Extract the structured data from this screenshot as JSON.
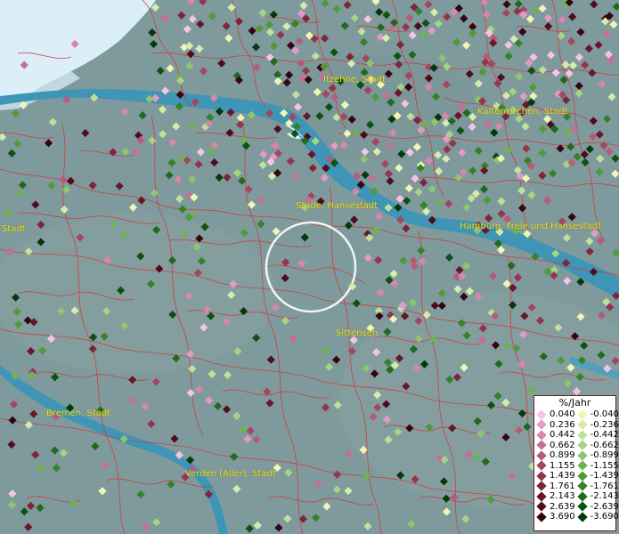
{
  "map": {
    "cities": [
      {
        "name": "Itzehoe, Stadt"
      },
      {
        "name": "Kaltenkirchen, Stadt"
      },
      {
        "name": "Stade, Hansestadt"
      },
      {
        "name": "Hamburg, Freie und Hansestadt"
      },
      {
        "name": "Stadt"
      },
      {
        "name": "Sittensen"
      },
      {
        "name": "Bremen, Stadt"
      },
      {
        "name": "Verden (Aller), Stadt"
      }
    ]
  },
  "legend": {
    "title": "%/Jahr",
    "positive": [
      {
        "value": "0.040",
        "color": "#f4c4e6"
      },
      {
        "value": "0.236",
        "color": "#e29ac8"
      },
      {
        "value": "0.442",
        "color": "#d786ad"
      },
      {
        "value": "0.662",
        "color": "#c66f95"
      },
      {
        "value": "0.899",
        "color": "#b85a7c"
      },
      {
        "value": "1.155",
        "color": "#a54660"
      },
      {
        "value": "1.439",
        "color": "#93354d"
      },
      {
        "value": "1.761",
        "color": "#7f253a"
      },
      {
        "value": "2.143",
        "color": "#69162a"
      },
      {
        "value": "2.639",
        "color": "#500c1c"
      },
      {
        "value": "3.690",
        "color": "#360510"
      }
    ],
    "negative": [
      {
        "value": "-0.040",
        "color": "#eef7b4"
      },
      {
        "value": "-0.236",
        "color": "#d7ecaa"
      },
      {
        "value": "-0.442",
        "color": "#c0e19a"
      },
      {
        "value": "-0.662",
        "color": "#a6d484"
      },
      {
        "value": "-0.899",
        "color": "#8cc66d"
      },
      {
        "value": "-1.155",
        "color": "#6eb251"
      },
      {
        "value": "-1.439",
        "color": "#4f9a3a"
      },
      {
        "value": "-1.761",
        "color": "#358229"
      },
      {
        "value": "-2.143",
        "color": "#1f6a1d"
      },
      {
        "value": "-2.639",
        "color": "#0e5213"
      },
      {
        "value": "-3.690",
        "color": "#033a0b"
      }
    ]
  },
  "colors": {
    "land": "#7f9a9c",
    "water": "#3f95b5",
    "snow": "#dceff8",
    "border": "#d13a3a",
    "city_label": "#f0e21a",
    "circle": "#ffffff"
  }
}
